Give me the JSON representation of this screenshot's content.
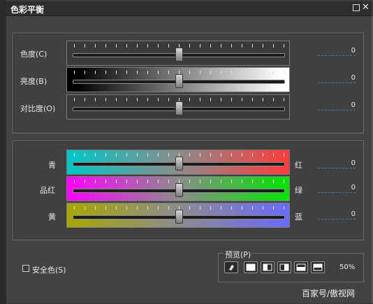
{
  "window": {
    "title": "色彩平衡"
  },
  "sliders_top": [
    {
      "label": "色度(C)",
      "value": "0",
      "position": 0.5
    },
    {
      "label": "亮度(B)",
      "value": "0",
      "position": 0.5
    },
    {
      "label": "对比度(O)",
      "value": "0",
      "position": 0.5
    }
  ],
  "sliders_color": [
    {
      "left": "青",
      "right": "红",
      "value": "0",
      "position": 0.5
    },
    {
      "left": "品红",
      "right": "绿",
      "value": "0",
      "position": 0.5
    },
    {
      "left": "黄",
      "right": "蓝",
      "value": "0",
      "position": 0.5
    }
  ],
  "safe_color": {
    "label": "安全色(S)",
    "checked": false
  },
  "preview": {
    "label": "预览(P)",
    "zoom": "50%"
  },
  "watermark": "百家号/傲视网",
  "colors": {
    "cyan": "#00c8c8",
    "red": "#ff3a3a",
    "magenta": "#ff00ff",
    "green": "#00e600",
    "yellow": "#a8a800",
    "blue": "#6a6aff",
    "value_underline": "#3f7fbf"
  },
  "icons": [
    "minimize-icon",
    "close-icon",
    "eraser-icon",
    "preview-full-icon",
    "preview-split-vertical-icon",
    "preview-split-half-icon",
    "preview-split-top-icon",
    "preview-split-bottom-icon"
  ]
}
